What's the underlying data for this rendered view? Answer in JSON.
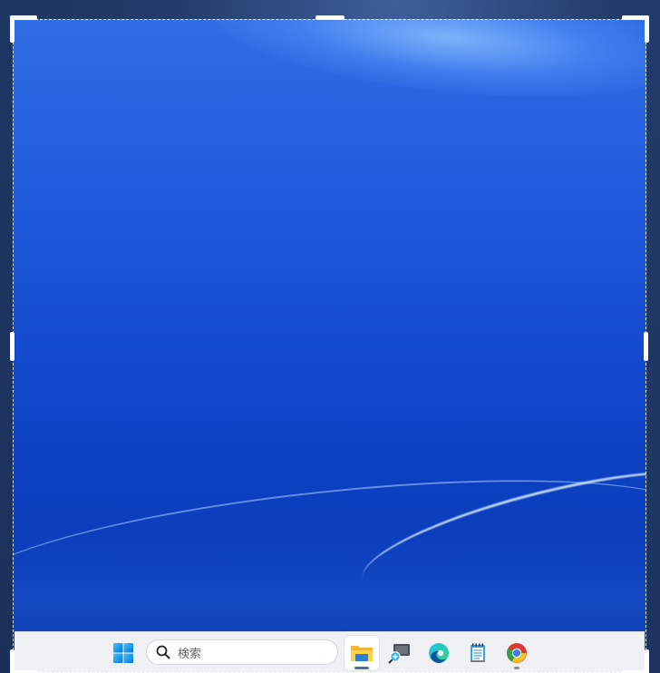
{
  "taskbar": {
    "search": {
      "placeholder": "検索"
    },
    "apps": [
      {
        "icon": "windows-start-icon"
      },
      {
        "icon": "file-explorer-icon",
        "active": true
      },
      {
        "icon": "magnifier-app-icon"
      },
      {
        "icon": "edge-browser-icon"
      },
      {
        "icon": "notepad-icon"
      },
      {
        "icon": "chrome-browser-icon",
        "running": true
      }
    ]
  },
  "colors": {
    "wallpaper_top": "#2f6ee6",
    "wallpaper_bottom": "#0b3aa8",
    "taskbar_bg": "#eef0f3",
    "selection_border": "#ffffff"
  }
}
